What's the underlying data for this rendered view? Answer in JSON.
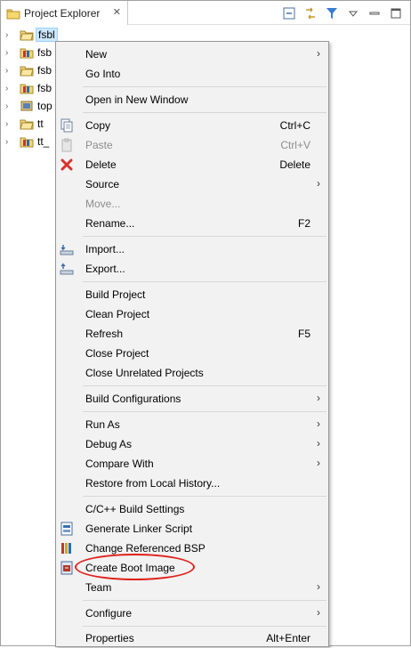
{
  "view": {
    "tab_title": "Project Explorer",
    "close_glyph": "✕"
  },
  "tree": {
    "rows": [
      {
        "label": "fsbl",
        "icon": "project-folder-icon"
      },
      {
        "label": "fsb",
        "icon": "bsp-project-icon"
      },
      {
        "label": "fsb",
        "icon": "project-folder-icon"
      },
      {
        "label": "fsb",
        "icon": "bsp-project-icon"
      },
      {
        "label": "top",
        "icon": "hardware-platform-icon"
      },
      {
        "label": "tt",
        "icon": "project-folder-icon"
      },
      {
        "label": "tt_",
        "icon": "bsp-project-icon"
      }
    ],
    "chevron": "›"
  },
  "menu": {
    "new": "New",
    "go_into": "Go Into",
    "open_new_window": "Open in New Window",
    "copy": "Copy",
    "copy_acc": "Ctrl+C",
    "paste": "Paste",
    "paste_acc": "Ctrl+V",
    "delete": "Delete",
    "delete_acc": "Delete",
    "source": "Source",
    "move": "Move...",
    "rename": "Rename...",
    "rename_acc": "F2",
    "import": "Import...",
    "export": "Export...",
    "build_project": "Build Project",
    "clean_project": "Clean Project",
    "refresh": "Refresh",
    "refresh_acc": "F5",
    "close_project": "Close Project",
    "close_unrelated": "Close Unrelated Projects",
    "build_configurations": "Build Configurations",
    "run_as": "Run As",
    "debug_as": "Debug As",
    "compare_with": "Compare With",
    "restore_local": "Restore from Local History...",
    "cpp_build_settings": "C/C++ Build Settings",
    "generate_linker": "Generate Linker Script",
    "change_bsp": "Change Referenced BSP",
    "create_boot_image": "Create Boot Image",
    "team": "Team",
    "configure": "Configure",
    "properties": "Properties",
    "properties_acc": "Alt+Enter",
    "submenu_glyph": "›"
  },
  "colors": {
    "menu_bg": "#f2f2f2",
    "selection": "#cce8ff",
    "annotation": "#e0211b"
  }
}
